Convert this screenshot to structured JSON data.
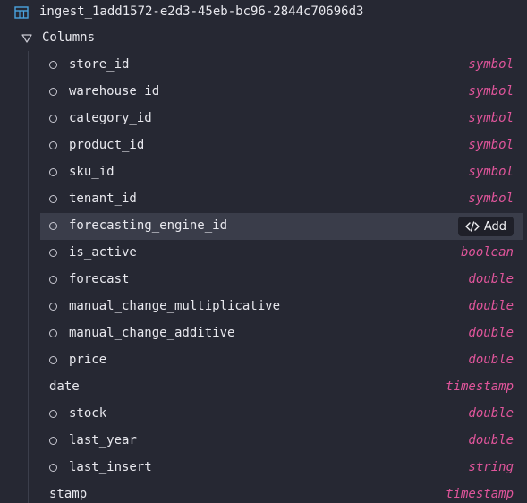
{
  "table": {
    "name": "ingest_1add1572-e2d3-45eb-bc96-2844c70696d3",
    "icon": "table-icon"
  },
  "columns_section": {
    "label": "Columns",
    "icon": "caret-down-icon"
  },
  "columns": [
    {
      "name": "store_id",
      "type": "symbol",
      "has_circle": true
    },
    {
      "name": "warehouse_id",
      "type": "symbol",
      "has_circle": true
    },
    {
      "name": "category_id",
      "type": "symbol",
      "has_circle": true
    },
    {
      "name": "product_id",
      "type": "symbol",
      "has_circle": true
    },
    {
      "name": "sku_id",
      "type": "symbol",
      "has_circle": true
    },
    {
      "name": "tenant_id",
      "type": "symbol",
      "has_circle": true
    },
    {
      "name": "forecasting_engine_id",
      "type": "",
      "has_circle": true,
      "hovered": true
    },
    {
      "name": "is_active",
      "type": "boolean",
      "has_circle": true
    },
    {
      "name": "forecast",
      "type": "double",
      "has_circle": true
    },
    {
      "name": "manual_change_multiplicative",
      "type": "double",
      "has_circle": true
    },
    {
      "name": "manual_change_additive",
      "type": "double",
      "has_circle": true
    },
    {
      "name": "price",
      "type": "double",
      "has_circle": true
    },
    {
      "name": "date",
      "type": "timestamp",
      "has_circle": false
    },
    {
      "name": "stock",
      "type": "double",
      "has_circle": true
    },
    {
      "name": "last_year",
      "type": "double",
      "has_circle": true
    },
    {
      "name": "last_insert",
      "type": "string",
      "has_circle": true
    },
    {
      "name": "stamp",
      "type": "timestamp",
      "has_circle": false
    }
  ],
  "add_button": {
    "label": "Add",
    "icon": "code-icon"
  },
  "colors": {
    "background": "#262833",
    "type_accent": "#e0559b",
    "highlight": "#3a3d4a",
    "table_icon": "#4aa3df"
  }
}
